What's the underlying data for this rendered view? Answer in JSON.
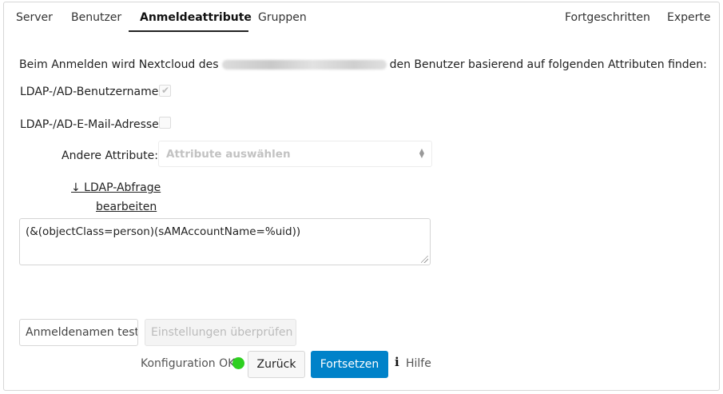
{
  "tabs": {
    "server": "Server",
    "benutzer": "Benutzer",
    "anmeldeattribute": "Anmeldeattribute",
    "gruppen": "Gruppen",
    "fortgeschritten": "Fortgeschritten",
    "experte": "Experte"
  },
  "login": {
    "intro_before": "Beim Anmelden wird Nextcloud des",
    "intro_after": "den Benutzer basierend auf folgenden Attributen finden:",
    "username_label": "LDAP-/AD-Benutzername:",
    "username_checked": true,
    "email_label": "LDAP-/AD-E-Mail-Adresse:",
    "email_checked": false,
    "other_attr_label": "Andere Attribute:",
    "other_attr_placeholder": "Attribute auswählen",
    "edit_query_line1": "↓ LDAP-Abfrage",
    "edit_query_line2": "bearbeiten",
    "filter_value": "(&(objectClass=person)(sAMAccountName=%uid))"
  },
  "actions": {
    "test_login_name": "Anmeldenamen testen",
    "verify_settings": "Einstellungen überprüfen",
    "config_status": "Konfiguration OK",
    "back": "Zurück",
    "continue": "Fortsetzen",
    "help": "Hilfe"
  },
  "colors": {
    "primary": "#0082c9",
    "status_ok": "#2ed020"
  },
  "icons": {
    "status": "green-dot",
    "help": "info-icon",
    "select": "sort-arrows-icon"
  }
}
